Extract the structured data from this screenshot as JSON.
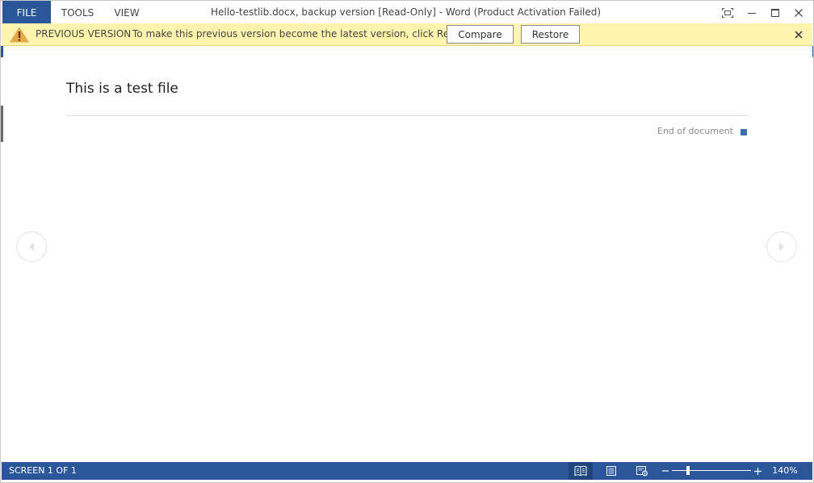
{
  "titlebar": {
    "menu": {
      "file": "FILE",
      "tools": "TOOLS",
      "view": "VIEW"
    },
    "title": "Hello-testlib.docx, backup version [Read-Only] - Word (Product Activation Failed)"
  },
  "message_bar": {
    "title": "PREVIOUS VERSION",
    "text": "To make this previous version become the latest version, click Restore.",
    "compare_label": "Compare",
    "restore_label": "Restore"
  },
  "document": {
    "heading": "This is a test file",
    "end_marker": "End of document"
  },
  "statusbar": {
    "screen": "SCREEN 1 OF 1",
    "zoom_level": "140%",
    "zoom_fraction": 0.2
  },
  "colors": {
    "accent": "#2b579a",
    "message_bar": "#fff4ad"
  },
  "icons": {
    "window": [
      "fullscreen-icon",
      "minimize-icon",
      "maximize-icon",
      "close-icon"
    ],
    "message": [
      "warning-icon",
      "close-icon"
    ],
    "nav": [
      "previous-screen-icon",
      "next-screen-icon"
    ],
    "views": [
      "read-mode-icon",
      "print-layout-icon",
      "web-layout-icon"
    ]
  }
}
